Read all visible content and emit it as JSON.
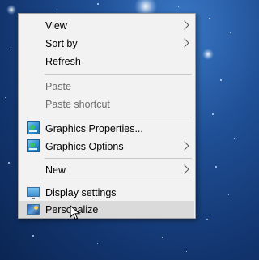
{
  "context_menu": {
    "items": [
      {
        "label": "View",
        "submenu": true,
        "enabled": true
      },
      {
        "label": "Sort by",
        "submenu": true,
        "enabled": true
      },
      {
        "label": "Refresh",
        "enabled": true
      },
      {
        "label": "Paste",
        "enabled": false
      },
      {
        "label": "Paste shortcut",
        "enabled": false
      },
      {
        "label": "Graphics Properties...",
        "icon": "graphics-icon",
        "enabled": true
      },
      {
        "label": "Graphics Options",
        "icon": "graphics-icon",
        "submenu": true,
        "enabled": true
      },
      {
        "label": "New",
        "submenu": true,
        "enabled": true
      },
      {
        "label": "Display settings",
        "icon": "display-icon",
        "enabled": true
      },
      {
        "label": "Personalize",
        "icon": "personalize-icon",
        "enabled": true,
        "highlighted": true
      }
    ]
  },
  "colors": {
    "menu_background": "#f2f2f2",
    "highlight": "#dadada",
    "disabled_text": "#6d6d6d",
    "desktop_background": "#1f4f95"
  },
  "cursor": "arrow-pointer-icon"
}
